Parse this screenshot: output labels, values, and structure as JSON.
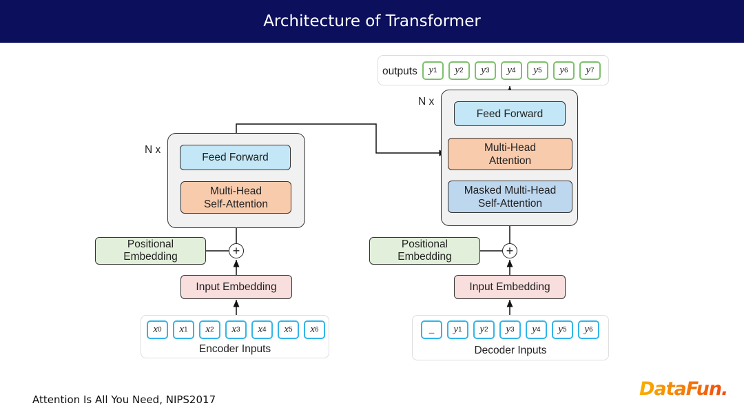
{
  "title": "Architecture of Transformer",
  "encoder": {
    "repeat_label": "N x",
    "feed_forward": "Feed Forward",
    "attention": [
      "Multi-Head",
      "Self-Attention"
    ],
    "positional_embedding": [
      "Positional",
      "Embedding"
    ],
    "input_embedding": "Input Embedding",
    "inputs_label": "Encoder Inputs",
    "tokens": [
      {
        "v": "x",
        "s": "0"
      },
      {
        "v": "x",
        "s": "1"
      },
      {
        "v": "x",
        "s": "2"
      },
      {
        "v": "x",
        "s": "3"
      },
      {
        "v": "x",
        "s": "4"
      },
      {
        "v": "x",
        "s": "5"
      },
      {
        "v": "x",
        "s": "6"
      }
    ]
  },
  "decoder": {
    "repeat_label": "N x",
    "feed_forward": "Feed Forward",
    "cross_attention": [
      "Multi-Head",
      "Attention"
    ],
    "masked_attention": [
      "Masked Multi-Head",
      "Self-Attention"
    ],
    "positional_embedding": [
      "Positional",
      "Embedding"
    ],
    "input_embedding": "Input Embedding",
    "inputs_label": "Decoder Inputs",
    "tokens": [
      {
        "v": "_",
        "s": ""
      },
      {
        "v": "y",
        "s": "1"
      },
      {
        "v": "y",
        "s": "2"
      },
      {
        "v": "y",
        "s": "3"
      },
      {
        "v": "y",
        "s": "4"
      },
      {
        "v": "y",
        "s": "5"
      },
      {
        "v": "y",
        "s": "6"
      }
    ]
  },
  "outputs": {
    "label": "outputs",
    "tokens": [
      {
        "v": "y",
        "s": "1"
      },
      {
        "v": "y",
        "s": "2"
      },
      {
        "v": "y",
        "s": "3"
      },
      {
        "v": "y",
        "s": "4"
      },
      {
        "v": "y",
        "s": "5"
      },
      {
        "v": "y",
        "s": "6"
      },
      {
        "v": "y",
        "s": "7"
      }
    ]
  },
  "plus_symbol": "+",
  "footer": "Attention Is All You Need, NIPS2017",
  "logo": "DataFun.",
  "colors": {
    "header": "#0c0f5c",
    "feed_forward": "#c3e7f6",
    "attention": "#f8cbad",
    "masked_attention": "#bdd7ee",
    "positional": "#e2efda",
    "input_embedding": "#f9dede",
    "input_token_border": "#33b5e8",
    "output_token_border": "#7bc16a"
  }
}
